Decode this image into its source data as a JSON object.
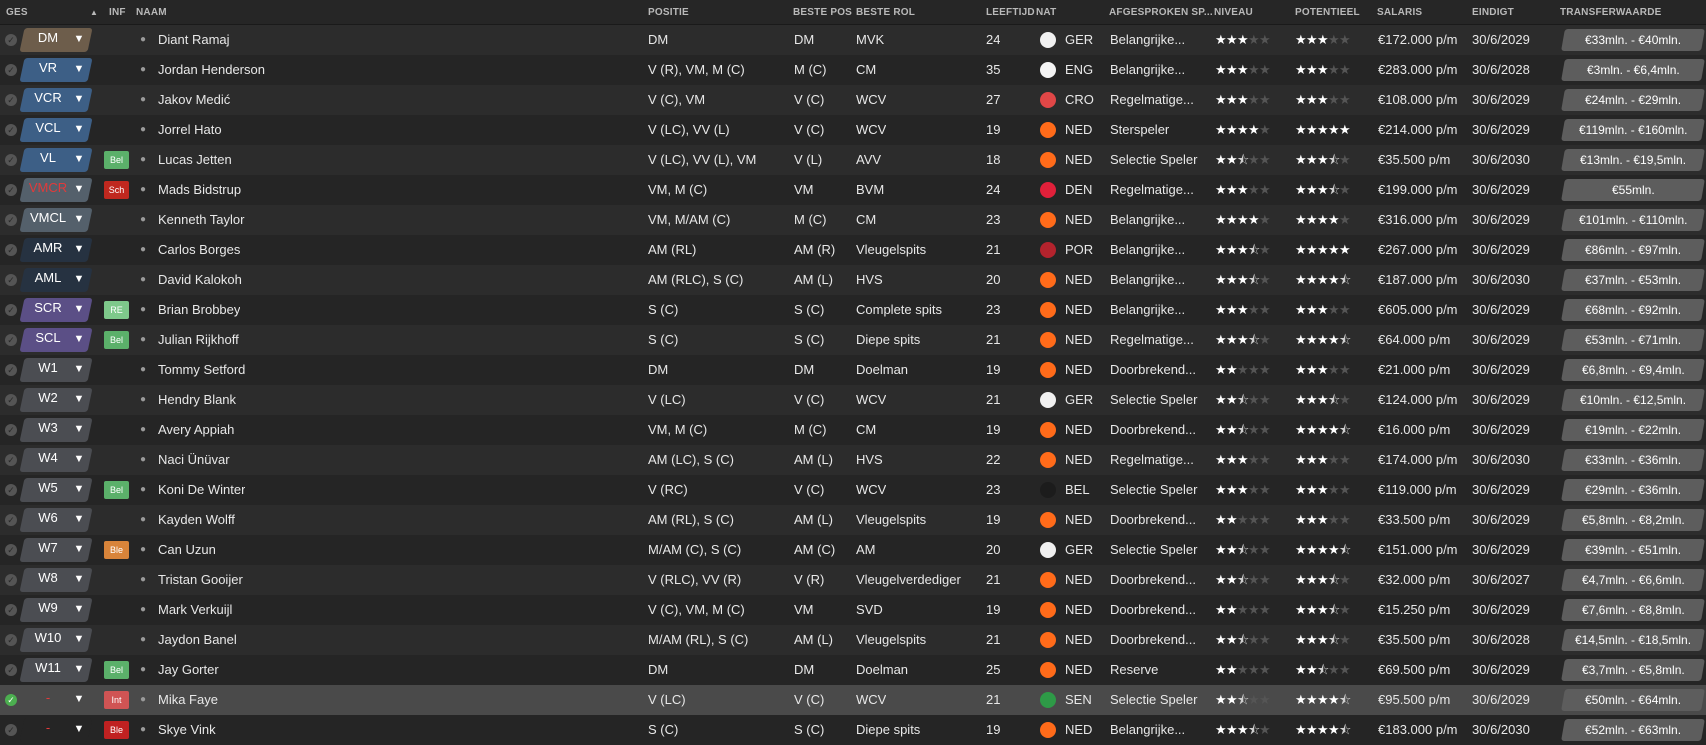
{
  "header": {
    "ges": "GES",
    "sort_arrow": "▲",
    "inf": "INF",
    "naam": "NAAM",
    "positie": "POSITIE",
    "beste_pos": "BESTE POS",
    "beste_rol": "BESTE ROL",
    "leeftijd": "LEEFTIJD",
    "nat": "NAT",
    "afgesproken": "AFGESPROKEN SP...",
    "niveau": "NIVEAU",
    "potentieel": "POTENTIEEL",
    "salaris": "SALARIS",
    "eindigt": "EINDIGT",
    "transferwaarde": "TRANSFERWAARDE"
  },
  "colors": {
    "pos_brown": "#6d5d4b",
    "pos_blue": "#3d5f86",
    "pos_slate": "#54606b",
    "pos_dark": "#263241",
    "pos_purple": "#5b4f86",
    "pos_gray": "#4b4d52",
    "inf_bel": "#5bb06a",
    "inf_sch": "#c0281f",
    "inf_re": "#7ec98b",
    "inf_ble": "#d8843a",
    "inf_int": "#d05454",
    "inf_ble_red": "#c02121",
    "pos_red_text": "#e23a3a",
    "flag_ger": "#f1f1f1",
    "flag_eng": "#f4f4f4",
    "flag_cro": "#e04747",
    "flag_ned": "#ff6b1a",
    "flag_den": "#e0203a",
    "flag_por": "#b3232d",
    "flag_bel": "#1c1c1c",
    "flag_sen": "#2e9a47"
  },
  "players": [
    {
      "pos": "DM",
      "pos_color": "#6d5d4b",
      "pos_text_color": "#ffffff",
      "inf": "",
      "inf_color": "",
      "name": "Diant Ramaj",
      "positie": "DM",
      "beste_pos": "DM",
      "beste_rol": "MVK",
      "age": "24",
      "nat": "GER",
      "flag": "#f1f1f1",
      "afgesproken": "Belangrijke...",
      "niveau": 3,
      "potentieel": 3,
      "salaris": "€172.000 p/m",
      "eindigt": "30/6/2029",
      "tv": "€33mln. - €40mln.",
      "checked": false
    },
    {
      "pos": "VR",
      "pos_color": "#3d5f86",
      "pos_text_color": "#ffffff",
      "inf": "",
      "inf_color": "",
      "name": "Jordan Henderson",
      "positie": "V (R), VM, M (C)",
      "beste_pos": "M (C)",
      "beste_rol": "CM",
      "age": "35",
      "nat": "ENG",
      "flag": "#f4f4f4",
      "afgesproken": "Belangrijke...",
      "niveau": 3,
      "potentieel": 3,
      "salaris": "€283.000 p/m",
      "eindigt": "30/6/2028",
      "tv": "€3mln. - €6,4mln.",
      "checked": false
    },
    {
      "pos": "VCR",
      "pos_color": "#3d5f86",
      "pos_text_color": "#ffffff",
      "inf": "",
      "inf_color": "",
      "name": "Jakov Medić",
      "positie": "V (C), VM",
      "beste_pos": "V (C)",
      "beste_rol": "WCV",
      "age": "27",
      "nat": "CRO",
      "flag": "#e04747",
      "afgesproken": "Regelmatige...",
      "niveau": 3,
      "potentieel": 3,
      "salaris": "€108.000 p/m",
      "eindigt": "30/6/2029",
      "tv": "€24mln. - €29mln.",
      "checked": false
    },
    {
      "pos": "VCL",
      "pos_color": "#3d5f86",
      "pos_text_color": "#ffffff",
      "inf": "",
      "inf_color": "",
      "name": "Jorrel Hato",
      "positie": "V (LC), VV (L)",
      "beste_pos": "V (C)",
      "beste_rol": "WCV",
      "age": "19",
      "nat": "NED",
      "flag": "#ff6b1a",
      "afgesproken": "Sterspeler",
      "niveau": 4,
      "potentieel": 5,
      "salaris": "€214.000 p/m",
      "eindigt": "30/6/2029",
      "tv": "€119mln. - €160mln.",
      "checked": false
    },
    {
      "pos": "VL",
      "pos_color": "#3d5f86",
      "pos_text_color": "#ffffff",
      "inf": "Bel",
      "inf_color": "#5bb06a",
      "name": "Lucas Jetten",
      "positie": "V (LC), VV (L), VM",
      "beste_pos": "V (L)",
      "beste_rol": "AVV",
      "age": "18",
      "nat": "NED",
      "flag": "#ff6b1a",
      "afgesproken": "Selectie Speler",
      "niveau": 2.5,
      "potentieel": 3.5,
      "salaris": "€35.500 p/m",
      "eindigt": "30/6/2030",
      "tv": "€13mln. - €19,5mln.",
      "checked": false
    },
    {
      "pos": "VMCR",
      "pos_color": "#54606b",
      "pos_text_color": "#e23a3a",
      "inf": "Sch",
      "inf_color": "#c0281f",
      "name": "Mads Bidstrup",
      "positie": "VM, M (C)",
      "beste_pos": "VM",
      "beste_rol": "BVM",
      "age": "24",
      "nat": "DEN",
      "flag": "#e0203a",
      "afgesproken": "Regelmatige...",
      "niveau": 3,
      "potentieel": 3.5,
      "salaris": "€199.000 p/m",
      "eindigt": "30/6/2029",
      "tv": "€55mln.",
      "checked": false
    },
    {
      "pos": "VMCL",
      "pos_color": "#54606b",
      "pos_text_color": "#ffffff",
      "inf": "",
      "inf_color": "",
      "name": "Kenneth Taylor",
      "positie": "VM, M/AM (C)",
      "beste_pos": "M (C)",
      "beste_rol": "CM",
      "age": "23",
      "nat": "NED",
      "flag": "#ff6b1a",
      "afgesproken": "Belangrijke...",
      "niveau": 4,
      "potentieel": 4,
      "salaris": "€316.000 p/m",
      "eindigt": "30/6/2029",
      "tv": "€101mln. - €110mln.",
      "checked": false
    },
    {
      "pos": "AMR",
      "pos_color": "#263241",
      "pos_text_color": "#ffffff",
      "inf": "",
      "inf_color": "",
      "name": "Carlos Borges",
      "positie": "AM (RL)",
      "beste_pos": "AM (R)",
      "beste_rol": "Vleugelspits",
      "age": "21",
      "nat": "POR",
      "flag": "#b3232d",
      "afgesproken": "Belangrijke...",
      "niveau": 3.5,
      "potentieel": 5,
      "salaris": "€267.000 p/m",
      "eindigt": "30/6/2029",
      "tv": "€86mln. - €97mln.",
      "checked": false
    },
    {
      "pos": "AML",
      "pos_color": "#263241",
      "pos_text_color": "#ffffff",
      "inf": "",
      "inf_color": "",
      "name": "David Kalokoh",
      "positie": "AM (RLC), S (C)",
      "beste_pos": "AM (L)",
      "beste_rol": "HVS",
      "age": "20",
      "nat": "NED",
      "flag": "#ff6b1a",
      "afgesproken": "Belangrijke...",
      "niveau": 3.5,
      "potentieel": 4.5,
      "salaris": "€187.000 p/m",
      "eindigt": "30/6/2030",
      "tv": "€37mln. - €53mln.",
      "checked": false
    },
    {
      "pos": "SCR",
      "pos_color": "#5b4f86",
      "pos_text_color": "#ffffff",
      "inf": "RE",
      "inf_color": "#7ec98b",
      "name": "Brian Brobbey",
      "positie": "S (C)",
      "beste_pos": "S (C)",
      "beste_rol": "Complete spits",
      "age": "23",
      "nat": "NED",
      "flag": "#ff6b1a",
      "afgesproken": "Belangrijke...",
      "niveau": 3,
      "potentieel": 3,
      "salaris": "€605.000 p/m",
      "eindigt": "30/6/2029",
      "tv": "€68mln. - €92mln.",
      "checked": false
    },
    {
      "pos": "SCL",
      "pos_color": "#5b4f86",
      "pos_text_color": "#ffffff",
      "inf": "Bel",
      "inf_color": "#5bb06a",
      "name": "Julian Rijkhoff",
      "positie": "S (C)",
      "beste_pos": "S (C)",
      "beste_rol": "Diepe spits",
      "age": "21",
      "nat": "NED",
      "flag": "#ff6b1a",
      "afgesproken": "Regelmatige...",
      "niveau": 3.5,
      "potentieel": 4.5,
      "salaris": "€64.000 p/m",
      "eindigt": "30/6/2029",
      "tv": "€53mln. - €71mln.",
      "checked": false
    },
    {
      "pos": "W1",
      "pos_color": "#4b4d52",
      "pos_text_color": "#ffffff",
      "inf": "",
      "inf_color": "",
      "name": "Tommy Setford",
      "positie": "DM",
      "beste_pos": "DM",
      "beste_rol": "Doelman",
      "age": "19",
      "nat": "NED",
      "flag": "#ff6b1a",
      "afgesproken": "Doorbrekend...",
      "niveau": 2,
      "potentieel": 3,
      "salaris": "€21.000 p/m",
      "eindigt": "30/6/2029",
      "tv": "€6,8mln. - €9,4mln.",
      "checked": false
    },
    {
      "pos": "W2",
      "pos_color": "#4b4d52",
      "pos_text_color": "#ffffff",
      "inf": "",
      "inf_color": "",
      "name": "Hendry Blank",
      "positie": "V (LC)",
      "beste_pos": "V (C)",
      "beste_rol": "WCV",
      "age": "21",
      "nat": "GER",
      "flag": "#f1f1f1",
      "afgesproken": "Selectie Speler",
      "niveau": 2.5,
      "potentieel": 3.5,
      "salaris": "€124.000 p/m",
      "eindigt": "30/6/2029",
      "tv": "€10mln. - €12,5mln.",
      "checked": false
    },
    {
      "pos": "W3",
      "pos_color": "#4b4d52",
      "pos_text_color": "#ffffff",
      "inf": "",
      "inf_color": "",
      "name": "Avery Appiah",
      "positie": "VM, M (C)",
      "beste_pos": "M (C)",
      "beste_rol": "CM",
      "age": "19",
      "nat": "NED",
      "flag": "#ff6b1a",
      "afgesproken": "Doorbrekend...",
      "niveau": 2.5,
      "potentieel": 4.5,
      "salaris": "€16.000 p/m",
      "eindigt": "30/6/2029",
      "tv": "€19mln. - €22mln.",
      "checked": false
    },
    {
      "pos": "W4",
      "pos_color": "#4b4d52",
      "pos_text_color": "#ffffff",
      "inf": "",
      "inf_color": "",
      "name": "Naci Ünüvar",
      "positie": "AM (LC), S (C)",
      "beste_pos": "AM (L)",
      "beste_rol": "HVS",
      "age": "22",
      "nat": "NED",
      "flag": "#ff6b1a",
      "afgesproken": "Regelmatige...",
      "niveau": 3,
      "potentieel": 3,
      "salaris": "€174.000 p/m",
      "eindigt": "30/6/2030",
      "tv": "€33mln. - €36mln.",
      "checked": false
    },
    {
      "pos": "W5",
      "pos_color": "#4b4d52",
      "pos_text_color": "#ffffff",
      "inf": "Bel",
      "inf_color": "#5bb06a",
      "name": "Koni De Winter",
      "positie": "V (RC)",
      "beste_pos": "V (C)",
      "beste_rol": "WCV",
      "age": "23",
      "nat": "BEL",
      "flag": "#1c1c1c",
      "afgesproken": "Selectie Speler",
      "niveau": 3,
      "potentieel": 3,
      "salaris": "€119.000 p/m",
      "eindigt": "30/6/2029",
      "tv": "€29mln. - €36mln.",
      "checked": false
    },
    {
      "pos": "W6",
      "pos_color": "#4b4d52",
      "pos_text_color": "#ffffff",
      "inf": "",
      "inf_color": "",
      "name": "Kayden Wolff",
      "positie": "AM (RL), S (C)",
      "beste_pos": "AM (L)",
      "beste_rol": "Vleugelspits",
      "age": "19",
      "nat": "NED",
      "flag": "#ff6b1a",
      "afgesproken": "Doorbrekend...",
      "niveau": 2,
      "potentieel": 3,
      "salaris": "€33.500 p/m",
      "eindigt": "30/6/2029",
      "tv": "€5,8mln. - €8,2mln.",
      "checked": false
    },
    {
      "pos": "W7",
      "pos_color": "#4b4d52",
      "pos_text_color": "#ffffff",
      "inf": "Ble",
      "inf_color": "#d8843a",
      "name": "Can Uzun",
      "positie": "M/AM (C), S (C)",
      "beste_pos": "AM (C)",
      "beste_rol": "AM",
      "age": "20",
      "nat": "GER",
      "flag": "#f1f1f1",
      "afgesproken": "Selectie Speler",
      "niveau": 2.5,
      "potentieel": 4.5,
      "salaris": "€151.000 p/m",
      "eindigt": "30/6/2029",
      "tv": "€39mln. - €51mln.",
      "checked": false
    },
    {
      "pos": "W8",
      "pos_color": "#4b4d52",
      "pos_text_color": "#ffffff",
      "inf": "",
      "inf_color": "",
      "name": "Tristan Gooijer",
      "positie": "V (RLC), VV (R)",
      "beste_pos": "V (R)",
      "beste_rol": "Vleugelverdediger",
      "age": "21",
      "nat": "NED",
      "flag": "#ff6b1a",
      "afgesproken": "Doorbrekend...",
      "niveau": 2.5,
      "potentieel": 3.5,
      "salaris": "€32.000 p/m",
      "eindigt": "30/6/2027",
      "tv": "€4,7mln. - €6,6mln.",
      "checked": false
    },
    {
      "pos": "W9",
      "pos_color": "#4b4d52",
      "pos_text_color": "#ffffff",
      "inf": "",
      "inf_color": "",
      "name": "Mark Verkuijl",
      "positie": "V (C), VM, M (C)",
      "beste_pos": "VM",
      "beste_rol": "SVD",
      "age": "19",
      "nat": "NED",
      "flag": "#ff6b1a",
      "afgesproken": "Doorbrekend...",
      "niveau": 2,
      "potentieel": 3.5,
      "salaris": "€15.250 p/m",
      "eindigt": "30/6/2029",
      "tv": "€7,6mln. - €8,8mln.",
      "checked": false
    },
    {
      "pos": "W10",
      "pos_color": "#4b4d52",
      "pos_text_color": "#ffffff",
      "inf": "",
      "inf_color": "",
      "name": "Jaydon Banel",
      "positie": "M/AM (RL), S (C)",
      "beste_pos": "AM (L)",
      "beste_rol": "Vleugelspits",
      "age": "21",
      "nat": "NED",
      "flag": "#ff6b1a",
      "afgesproken": "Doorbrekend...",
      "niveau": 2.5,
      "potentieel": 3.5,
      "salaris": "€35.500 p/m",
      "eindigt": "30/6/2028",
      "tv": "€14,5mln. - €18,5mln.",
      "checked": false
    },
    {
      "pos": "W11",
      "pos_color": "#4b4d52",
      "pos_text_color": "#ffffff",
      "inf": "Bel",
      "inf_color": "#5bb06a",
      "name": "Jay Gorter",
      "positie": "DM",
      "beste_pos": "DM",
      "beste_rol": "Doelman",
      "age": "25",
      "nat": "NED",
      "flag": "#ff6b1a",
      "afgesproken": "Reserve",
      "niveau": 2,
      "potentieel": 2.5,
      "salaris": "€69.500 p/m",
      "eindigt": "30/6/2029",
      "tv": "€3,7mln. - €5,8mln.",
      "checked": false
    },
    {
      "pos": "-",
      "pos_color": "#4a4a4a",
      "pos_text_color": "#e23a3a",
      "inf": "Int",
      "inf_color": "#d05454",
      "name": "Mika Faye",
      "positie": "V (LC)",
      "beste_pos": "V (C)",
      "beste_rol": "WCV",
      "age": "21",
      "nat": "SEN",
      "flag": "#2e9a47",
      "afgesproken": "Selectie Speler",
      "niveau": 2.5,
      "potentieel": 4.5,
      "salaris": "€95.500 p/m",
      "eindigt": "30/6/2029",
      "tv": "€50mln. - €64mln.",
      "checked": true,
      "selected": true
    },
    {
      "pos": "-",
      "pos_color": "#252525",
      "pos_text_color": "#e23a3a",
      "inf": "Ble",
      "inf_color": "#c02121",
      "name": "Skye Vink",
      "positie": "S (C)",
      "beste_pos": "S (C)",
      "beste_rol": "Diepe spits",
      "age": "19",
      "nat": "NED",
      "flag": "#ff6b1a",
      "afgesproken": "Belangrijke...",
      "niveau": 3.5,
      "potentieel": 4.5,
      "salaris": "€183.000 p/m",
      "eindigt": "30/6/2030",
      "tv": "€52mln. - €63mln.",
      "checked": false
    }
  ]
}
